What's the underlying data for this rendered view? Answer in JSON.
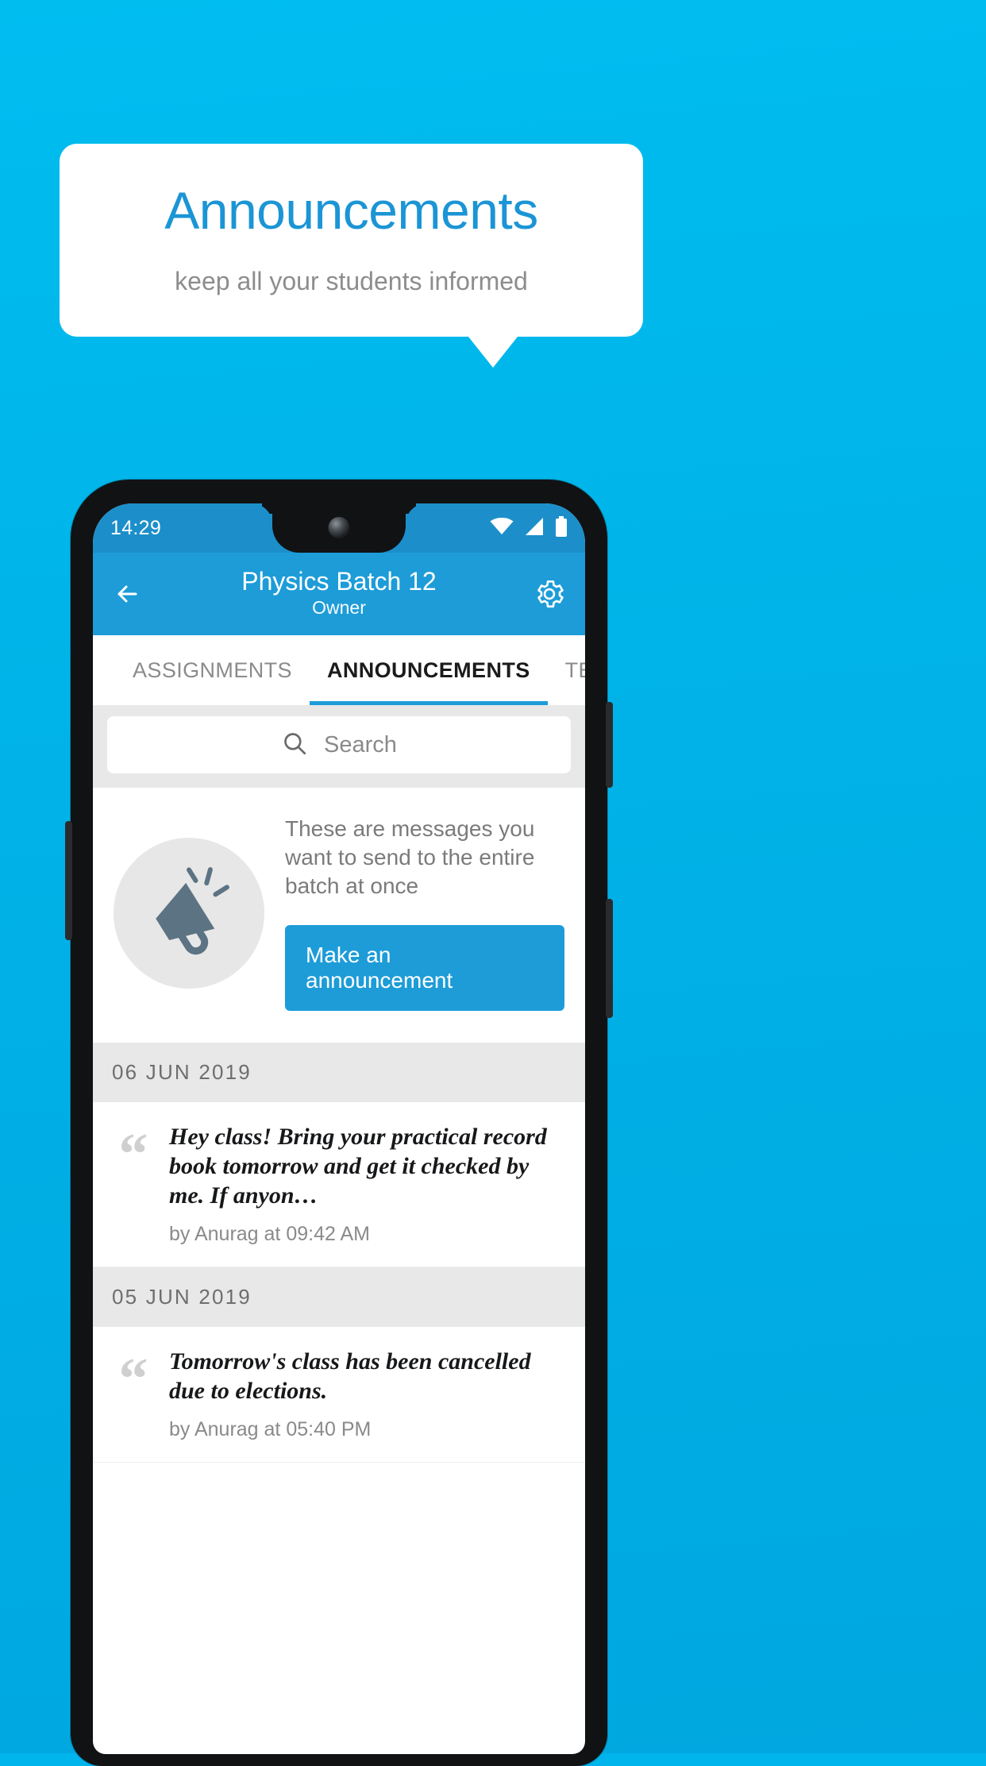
{
  "promo": {
    "title": "Announcements",
    "subtitle": "keep all your students informed",
    "bg_color": "#00b4ec",
    "title_color": "#1b95d5"
  },
  "phone": {
    "status_bar": {
      "clock": "14:29",
      "icons": [
        "wifi-icon",
        "signal-icon",
        "battery-icon"
      ],
      "bg_color": "#1c8fca"
    },
    "app_bar": {
      "back_icon": "back-arrow-icon",
      "title": "Physics Batch 12",
      "subtitle": "Owner",
      "settings_icon": "gear-icon",
      "bg_color": "#1d9cd8"
    },
    "tabs": [
      {
        "label": "ASSIGNMENTS",
        "active": false
      },
      {
        "label": "ANNOUNCEMENTS",
        "active": true
      },
      {
        "label": "TESTS",
        "active": false
      },
      {
        "label": "’",
        "active": false
      }
    ],
    "search": {
      "icon": "search-icon",
      "placeholder": "Search",
      "value": ""
    },
    "empty_state": {
      "illustration": "megaphone-icon",
      "description": "These are messages you want to send to the entire batch at once",
      "button_label": "Make an announcement",
      "button_color": "#1d9cd8"
    },
    "announcement_groups": [
      {
        "date": "06  JUN  2019",
        "items": [
          {
            "text": "Hey class! Bring your practical record book tomorrow and get it checked by me. If anyon…",
            "meta": "by Anurag at 09:42 AM"
          }
        ]
      },
      {
        "date": "05  JUN  2019",
        "items": [
          {
            "text": "Tomorrow's class has been cancelled due to elections.",
            "meta": "by Anurag at 05:40 PM"
          }
        ]
      }
    ]
  }
}
